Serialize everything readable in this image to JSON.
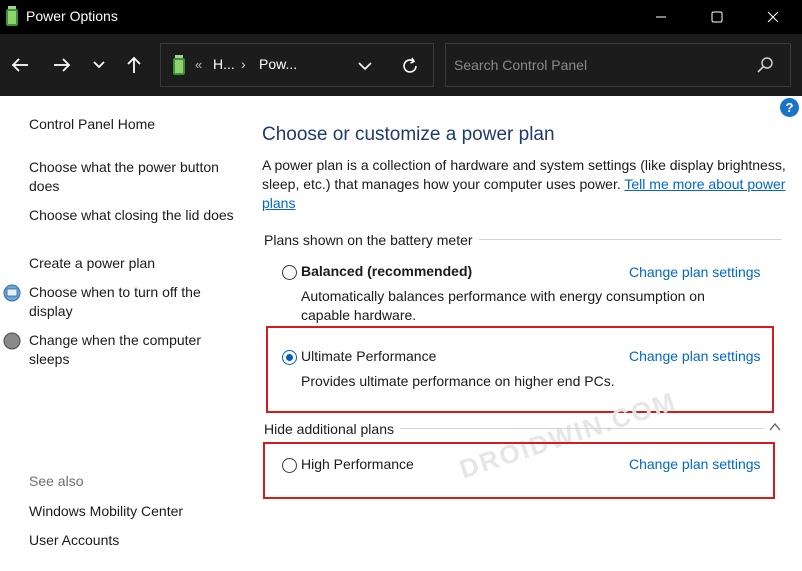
{
  "window": {
    "title": "Power Options",
    "controls": {
      "minimize_icon": "minimize-icon",
      "maximize_icon": "maximize-icon",
      "close_icon": "close-icon"
    }
  },
  "nav": {
    "breadcrumb": {
      "prefix": "«",
      "items": [
        "H...",
        "Pow..."
      ],
      "separator": "›"
    },
    "search": {
      "placeholder": "Search Control Panel"
    }
  },
  "sidebar": {
    "home": "Control Panel Home",
    "links": [
      "Choose what the power button does",
      "Choose what closing the lid does",
      "Create a power plan",
      "Choose when to turn off the display",
      "Change when the computer sleeps"
    ],
    "see_also": {
      "label": "See also",
      "links": [
        "Windows Mobility Center",
        "User Accounts"
      ]
    }
  },
  "main": {
    "help_label": "?",
    "heading": "Choose or customize a power plan",
    "description": "A power plan is a collection of hardware and system settings (like display brightness, sleep, etc.) that manages how your computer uses power.",
    "description_link": "Tell me more about power plans",
    "battery_section": "Plans shown on the battery meter",
    "hidden_section": "Hide additional plans",
    "plans": [
      {
        "name": "Balanced (recommended)",
        "description": "Automatically balances performance with energy consumption on capable hardware.",
        "selected": false,
        "link": "Change plan settings"
      },
      {
        "name": "Ultimate Performance",
        "description": "Provides ultimate performance on higher end PCs.",
        "selected": true,
        "link": "Change plan settings"
      },
      {
        "name": "High Performance",
        "description": "",
        "selected": false,
        "link": "Change plan settings"
      }
    ],
    "watermark": "DROIDWIN.COM"
  },
  "colors": {
    "titlebar": "#000000",
    "navbar": "#1c1c1c",
    "heading": "#1e3a6e",
    "link": "#0066cc",
    "highlight": "#d71a1a",
    "radio_selected": "#005fb8"
  }
}
